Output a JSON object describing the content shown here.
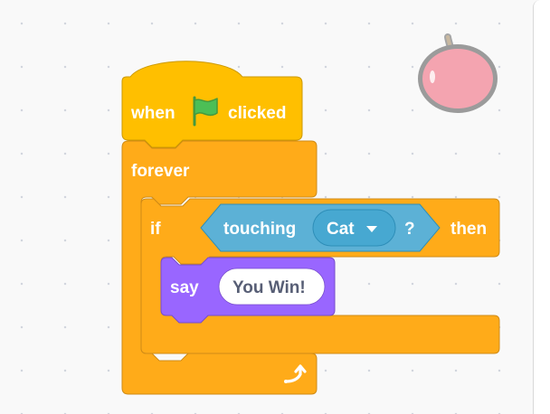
{
  "workspace": {
    "background": "#f9f9f9",
    "grid_dot_color": "#d2d6de"
  },
  "sprite": {
    "icon": "apple-sprite-icon",
    "fill": "#f4a4b0",
    "outline": "#9b9b9b"
  },
  "colors": {
    "events": "#ffbf00",
    "events_border": "#cc9900",
    "control": "#ffab19",
    "control_border": "#cf8b17",
    "sensing": "#5cb1d6",
    "sensing_border": "#2e8eb8",
    "sensing_dropdown": "#47a8d1",
    "looks": "#9966ff",
    "looks_border": "#774dcb",
    "flag": "#4cbf56"
  },
  "blocks": {
    "hat": {
      "prefix": "when",
      "flag_icon": "green-flag-icon",
      "suffix": "clicked"
    },
    "forever": {
      "label": "forever",
      "loop_icon": "repeat-arrow-icon"
    },
    "if_block": {
      "label": "if",
      "then_label": "then"
    },
    "touching": {
      "label": "touching",
      "dropdown_value": "Cat",
      "question": "?"
    },
    "say": {
      "label": "say",
      "message": "You Win!"
    }
  }
}
